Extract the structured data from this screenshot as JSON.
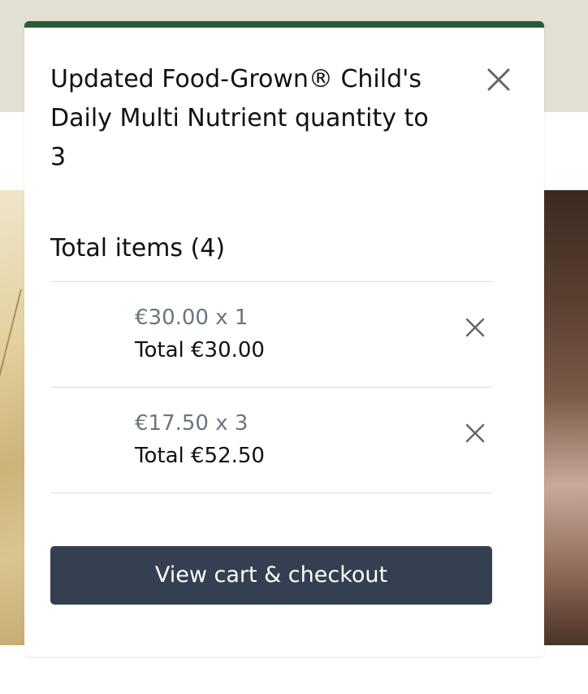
{
  "notification": {
    "message": "Updated Food-Grown® Child's Daily Multi Nutrient quantity to 3",
    "close_icon": "close-icon"
  },
  "cart": {
    "total_items_label": "Total items (4)",
    "items": [
      {
        "price_line": "€30.00 x 1",
        "total_line": "Total €30.00",
        "remove_icon": "close-icon"
      },
      {
        "price_line": "€17.50 x 3",
        "total_line": "Total €52.50",
        "remove_icon": "close-icon"
      }
    ],
    "checkout_label": "View cart & checkout"
  },
  "colors": {
    "accent_bar": "#2b5a3a",
    "checkout_button": "#344052",
    "price_text": "#6b7580",
    "top_band": "#e2dfd4"
  }
}
